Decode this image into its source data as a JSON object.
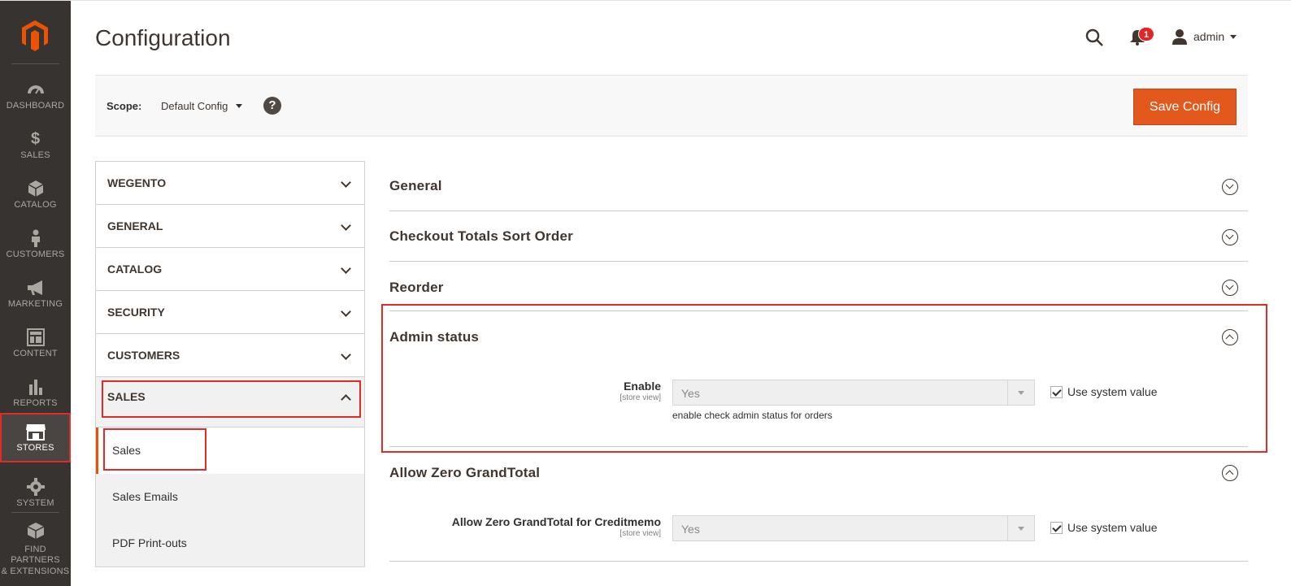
{
  "sidebar": {
    "logo": "magento-logo",
    "items": [
      {
        "label": "DASHBOARD",
        "icon": "dashboard-icon"
      },
      {
        "label": "SALES",
        "icon": "dollar-icon"
      },
      {
        "label": "CATALOG",
        "icon": "cube-icon"
      },
      {
        "label": "CUSTOMERS",
        "icon": "person-icon"
      },
      {
        "label": "MARKETING",
        "icon": "megaphone-icon"
      },
      {
        "label": "CONTENT",
        "icon": "layout-icon"
      },
      {
        "label": "REPORTS",
        "icon": "bar-chart-icon"
      },
      {
        "label": "STORES",
        "icon": "storefront-icon"
      },
      {
        "label": "SYSTEM",
        "icon": "gear-icon"
      },
      {
        "label_line1": "FIND PARTNERS",
        "label_line2": "& EXTENSIONS",
        "icon": "box-icon"
      }
    ]
  },
  "header": {
    "title": "Configuration",
    "notifications_count": "1",
    "user_name": "admin"
  },
  "scope": {
    "label": "Scope:",
    "value": "Default Config",
    "help": "?",
    "save_label": "Save Config"
  },
  "tabs": [
    {
      "label": "WEGENTO"
    },
    {
      "label": "GENERAL"
    },
    {
      "label": "CATALOG"
    },
    {
      "label": "SECURITY"
    },
    {
      "label": "CUSTOMERS"
    },
    {
      "label": "SALES"
    }
  ],
  "sales_subtabs": [
    {
      "label": "Sales"
    },
    {
      "label": "Sales Emails"
    },
    {
      "label": "PDF Print-outs"
    }
  ],
  "sections": {
    "general": {
      "title": "General"
    },
    "checkout_totals": {
      "title": "Checkout Totals Sort Order"
    },
    "reorder": {
      "title": "Reorder"
    },
    "admin_status": {
      "title": "Admin status",
      "field_label": "Enable",
      "scope_note": "[store view]",
      "value": "Yes",
      "use_system_label": "Use system value",
      "comment": "enable check admin status for orders"
    },
    "zero_grandtotal": {
      "title": "Allow Zero GrandTotal",
      "field_label": "Allow Zero GrandTotal for Creditmemo",
      "scope_note": "[store view]",
      "value": "Yes",
      "use_system_label": "Use system value"
    }
  },
  "colors": {
    "sidebar_bg": "#373330",
    "accent": "#eb5202",
    "save_button": "#e3581c",
    "highlight": "#e02b27"
  }
}
